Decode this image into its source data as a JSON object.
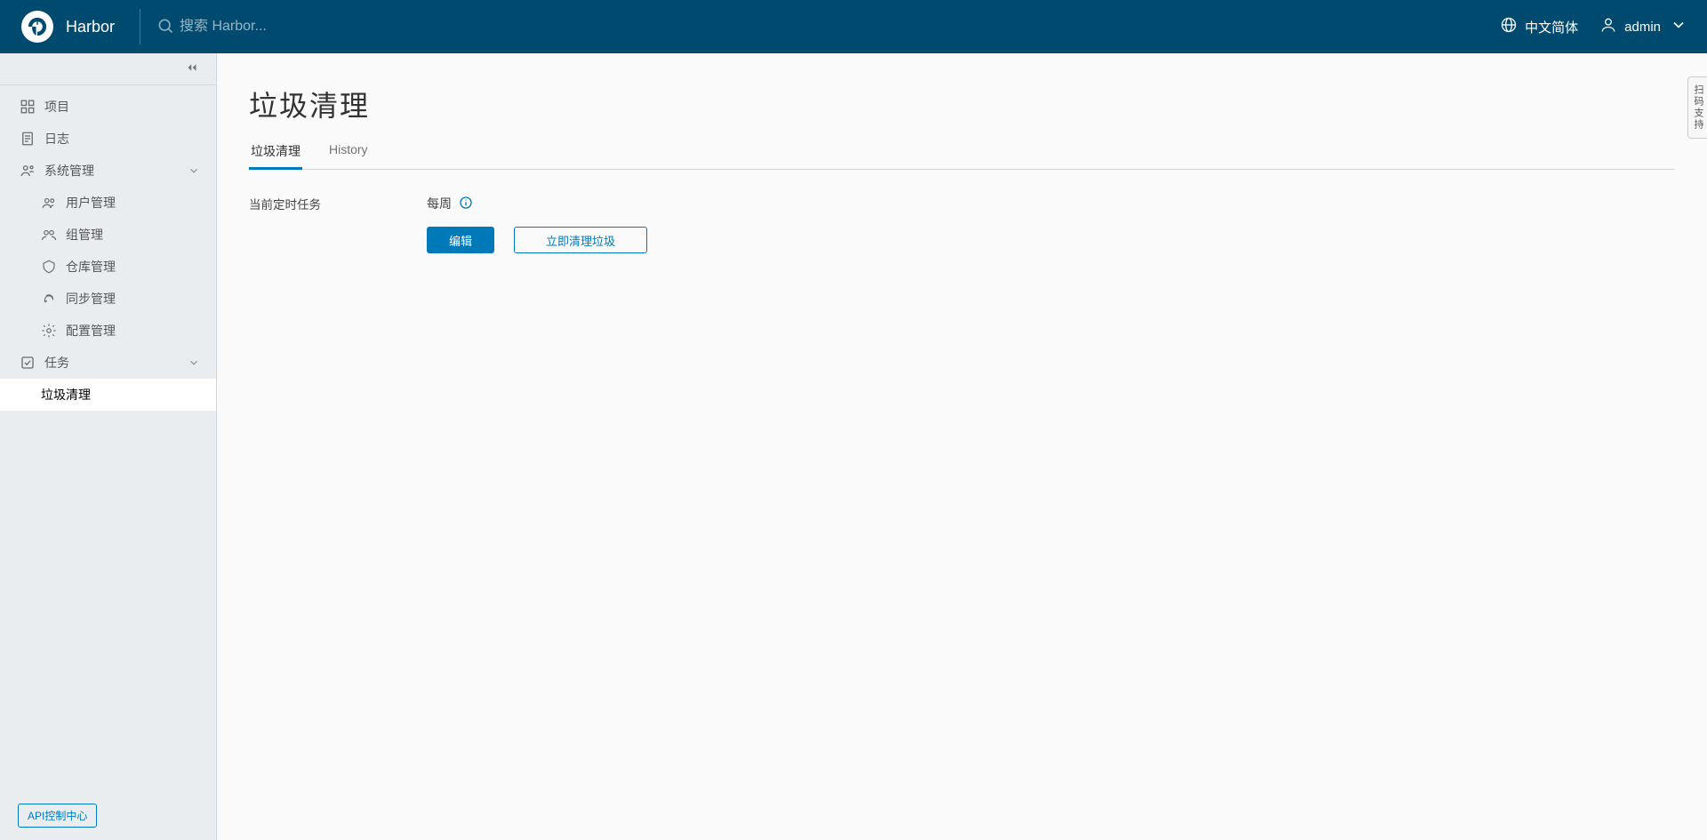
{
  "header": {
    "brand": "Harbor",
    "search_placeholder": "搜索 Harbor...",
    "lang_label": "中文简体",
    "user_label": "admin"
  },
  "sidebar": {
    "items": [
      {
        "label": "项目"
      },
      {
        "label": "日志"
      }
    ],
    "group_system": "系统管理",
    "system_items": [
      {
        "label": "用户管理"
      },
      {
        "label": "组管理"
      },
      {
        "label": "仓库管理"
      },
      {
        "label": "同步管理"
      },
      {
        "label": "配置管理"
      }
    ],
    "group_tasks": "任务",
    "task_items": [
      {
        "label": "垃圾清理"
      }
    ],
    "api_button": "API控制中心"
  },
  "main": {
    "title": "垃圾清理",
    "tabs": [
      {
        "label": "垃圾清理"
      },
      {
        "label": "History"
      }
    ],
    "schedule_label": "当前定时任务",
    "schedule_value": "每周",
    "edit_btn": "编辑",
    "gc_now_btn": "立即清理垃圾"
  },
  "float": {
    "label": "扫码支持"
  }
}
